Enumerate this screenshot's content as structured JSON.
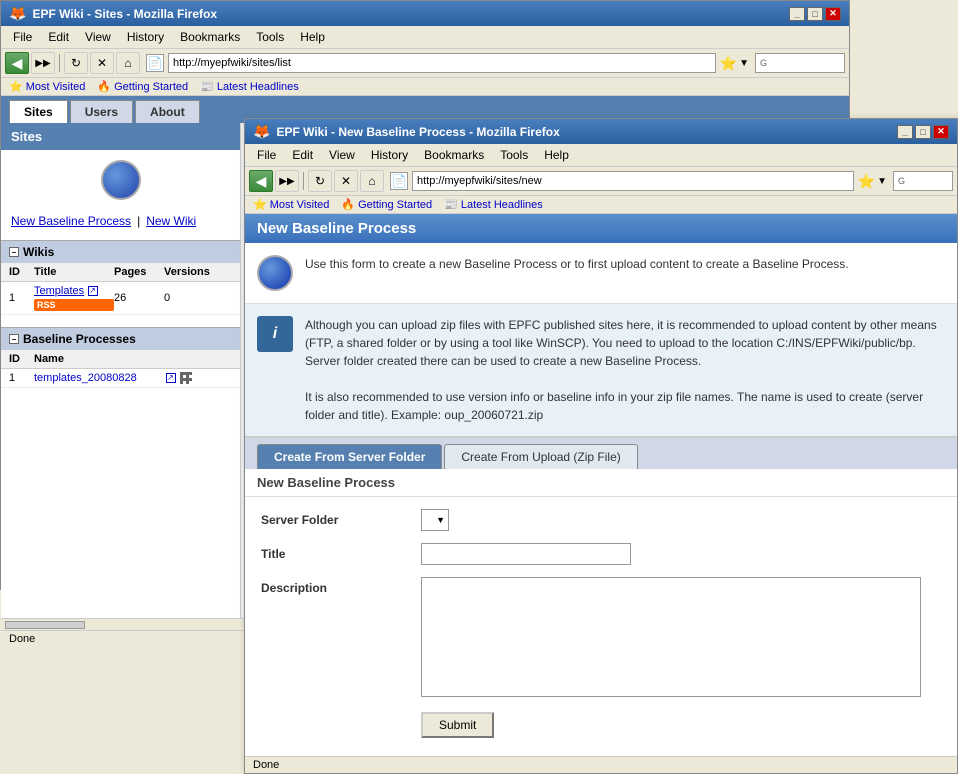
{
  "browser1": {
    "title": "EPF Wiki - Sites - Mozilla Firefox",
    "menu": [
      "File",
      "Edit",
      "View",
      "History",
      "Bookmarks",
      "Tools",
      "Help"
    ],
    "address": "http://myepfwiki/sites/list",
    "bookmarks": [
      "Most Visited",
      "Getting Started",
      "Latest Headlines"
    ],
    "tabs": [
      "Sites",
      "Users",
      "About"
    ],
    "active_tab": "Sites",
    "sidebar_title": "Sites",
    "new_baseline_link": "New Baseline Process",
    "new_wiki_link": "New Wiki",
    "wikis_section": "Wikis",
    "wikis_columns": [
      "ID",
      "Title",
      "Pages",
      "Versions"
    ],
    "wikis_rows": [
      {
        "id": "1",
        "title": "Templates",
        "pages": "26",
        "versions": "0"
      }
    ],
    "baseline_section": "Baseline Processes",
    "baseline_columns": [
      "ID",
      "Name"
    ],
    "baseline_rows": [
      {
        "id": "1",
        "name": "templates_20080828"
      }
    ],
    "status": "Done"
  },
  "browser2": {
    "title": "EPF Wiki - New Baseline Process - Mozilla Firefox",
    "menu": [
      "File",
      "Edit",
      "View",
      "History",
      "Bookmarks",
      "Tools",
      "Help"
    ],
    "address": "http://myepfwiki/sites/new",
    "bookmarks": [
      "Most Visited",
      "Getting Started",
      "Latest Headlines"
    ],
    "page_title": "New Baseline Process",
    "intro_text": "Use this form to create a new Baseline Process or to first upload content to create a Baseline Process.",
    "info_text_1": "Although you can upload zip files with EPFC published sites here, it is recommended to upload content by other means (FTP, a shared folder or by using a tool like WinSCP). You need to upload to the location C:/INS/EPFWiki/public/bp. Server folder created there can be used to create a new Baseline Process.",
    "info_text_2": "It is also recommended to use version info or baseline info in your zip file names. The name is used to create (server folder and title). Example: oup_20060721.zip",
    "tab_active": "Create From Server Folder",
    "tab_inactive": "Create From Upload (Zip File)",
    "form_subtitle": "New Baseline Process",
    "server_folder_label": "Server Folder",
    "title_label": "Title",
    "description_label": "Description",
    "submit_label": "Submit",
    "status": "Done"
  }
}
